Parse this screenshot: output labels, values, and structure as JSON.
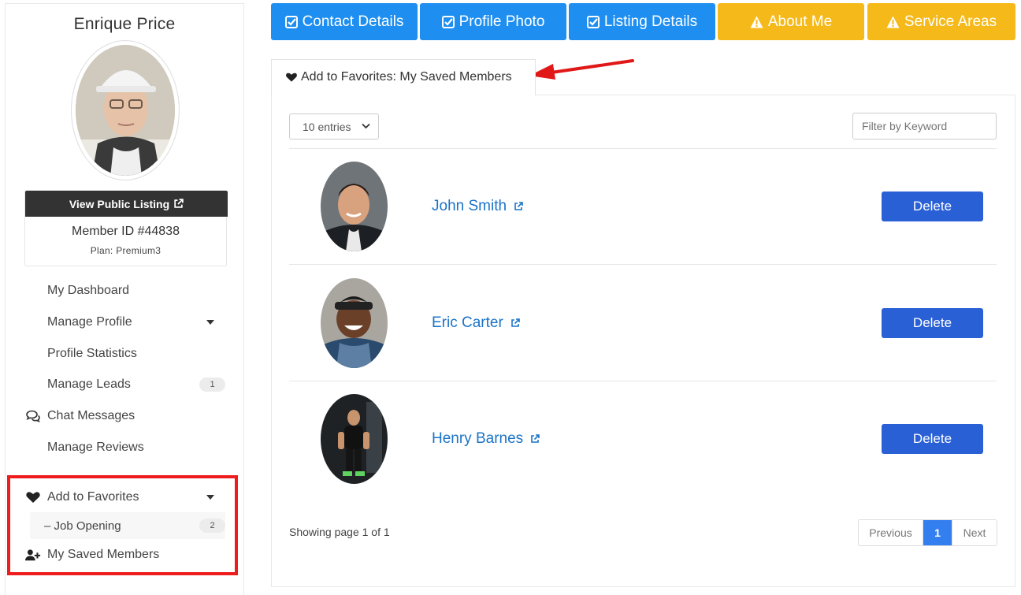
{
  "sidebar": {
    "member_name": "Enrique Price",
    "view_listing_label": "View Public Listing",
    "member_id": "Member ID #44838",
    "plan": "Plan: Premium3",
    "items": [
      {
        "label": "My Dashboard"
      },
      {
        "label": "Manage Profile"
      },
      {
        "label": "Profile Statistics"
      },
      {
        "label": "Manage Leads",
        "badge": "1"
      },
      {
        "label": "Chat Messages",
        "icon": "chat-icon"
      },
      {
        "label": "Manage Reviews"
      }
    ],
    "favorites": {
      "label": "Add to Favorites",
      "icon": "heart-icon",
      "sub_label": "– Job Opening",
      "sub_badge": "2",
      "saved_label": "My Saved Members",
      "saved_icon": "user-plus-icon"
    }
  },
  "top_tabs": [
    {
      "label": "Contact Details",
      "icon": "check-square-icon",
      "color": "#1e8ff0"
    },
    {
      "label": "Profile Photo",
      "icon": "check-square-icon",
      "color": "#1e8ff0"
    },
    {
      "label": "Listing Details",
      "icon": "check-square-icon",
      "color": "#1e8ff0"
    },
    {
      "label": "About Me",
      "icon": "warning-icon",
      "color": "#f6b91a"
    },
    {
      "label": "Service Areas",
      "icon": "warning-icon",
      "color": "#f6b91a"
    }
  ],
  "content": {
    "tab_label": "Add to Favorites: My Saved Members",
    "entries_label": "10 entries",
    "filter_placeholder": "Filter by Keyword",
    "members": [
      {
        "name": "John Smith",
        "action": "Delete"
      },
      {
        "name": "Eric Carter",
        "action": "Delete"
      },
      {
        "name": "Henry Barnes",
        "action": "Delete"
      }
    ],
    "showing": "Showing page 1 of 1",
    "pager": {
      "prev": "Previous",
      "current": "1",
      "next": "Next"
    }
  },
  "colors": {
    "blue_tab": "#1e8ff0",
    "yellow_tab": "#f6b91a",
    "delete": "#2a60d6",
    "link": "#1a73c8",
    "highlight": "#ee1c1c"
  }
}
